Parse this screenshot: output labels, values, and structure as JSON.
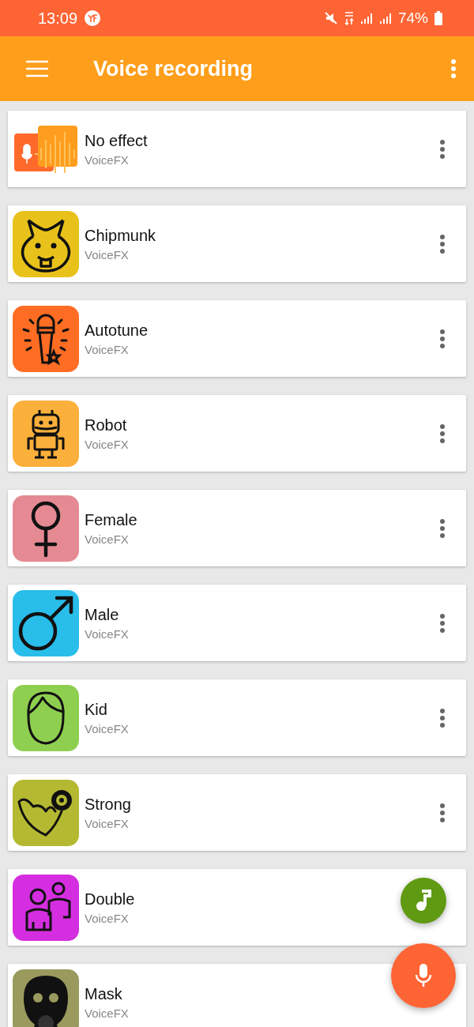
{
  "status_bar": {
    "time": "13:09",
    "battery": "74%"
  },
  "app_bar": {
    "title": "Voice recording"
  },
  "effects": [
    {
      "kind": "waveform",
      "title": "No effect",
      "subtitle": "VoiceFX",
      "color": "#ff6a2b",
      "menu": true
    },
    {
      "kind": "chipmunk",
      "title": "Chipmunk",
      "subtitle": "VoiceFX",
      "color": "#e8c21a",
      "menu": true
    },
    {
      "kind": "microphone",
      "title": "Autotune",
      "subtitle": "VoiceFX",
      "color": "#ff6d24",
      "menu": true
    },
    {
      "kind": "robot",
      "title": "Robot",
      "subtitle": "VoiceFX",
      "color": "#fbb03b",
      "menu": true
    },
    {
      "kind": "female",
      "title": "Female",
      "subtitle": "VoiceFX",
      "color": "#e58a92",
      "menu": true
    },
    {
      "kind": "male",
      "title": "Male",
      "subtitle": "VoiceFX",
      "color": "#29bdea",
      "menu": true
    },
    {
      "kind": "kid",
      "title": "Kid",
      "subtitle": "VoiceFX",
      "color": "#8fcf50",
      "menu": true
    },
    {
      "kind": "strong",
      "title": "Strong",
      "subtitle": "VoiceFX",
      "color": "#b5b932",
      "menu": true
    },
    {
      "kind": "double",
      "title": "Double",
      "subtitle": "VoiceFX",
      "color": "#d42ee0",
      "menu": false
    },
    {
      "kind": "mask",
      "title": "Mask",
      "subtitle": "VoiceFX",
      "color": "#9a9a5e",
      "menu": false
    }
  ]
}
